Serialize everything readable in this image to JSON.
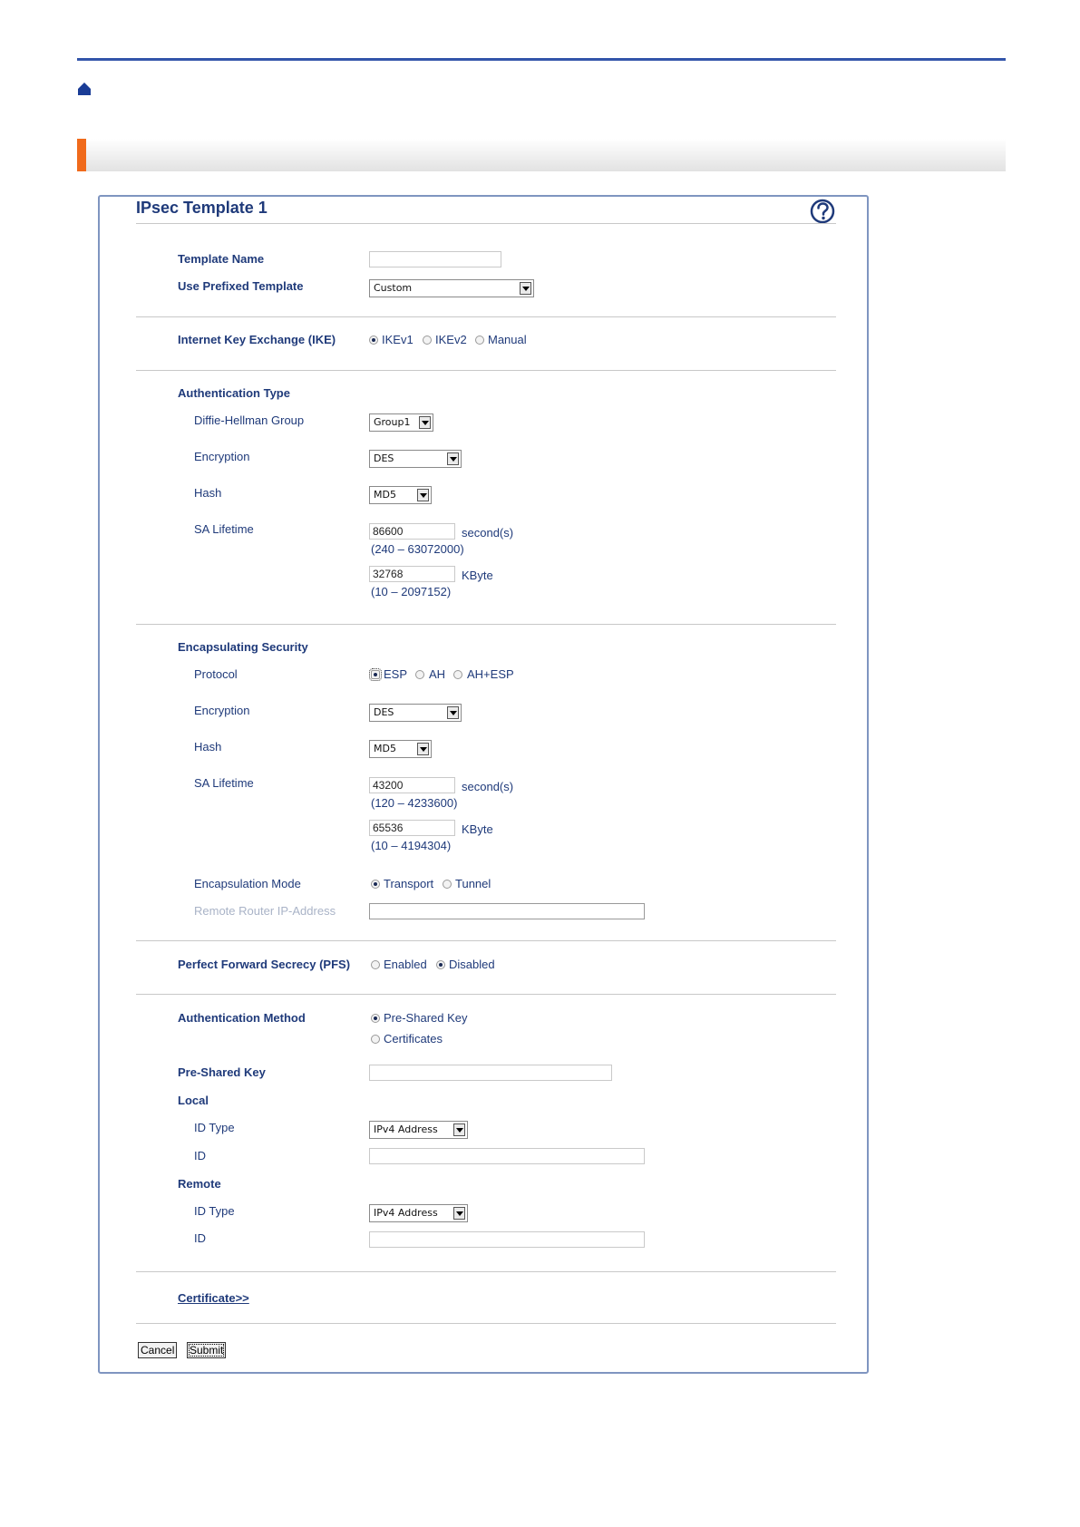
{
  "panel": {
    "title": "IPsec Template 1"
  },
  "fields": {
    "template_name": {
      "label": "Template Name",
      "value": ""
    },
    "prefixed_template": {
      "label": "Use Prefixed Template",
      "value": "Custom"
    },
    "ike": {
      "label": "Internet Key Exchange (IKE)",
      "options": [
        "IKEv1",
        "IKEv2",
        "Manual"
      ],
      "selected": "IKEv1"
    },
    "auth_type": {
      "heading": "Authentication Type",
      "dh_group": {
        "label": "Diffie-Hellman Group",
        "value": "Group1"
      },
      "encryption": {
        "label": "Encryption",
        "value": "DES"
      },
      "hash": {
        "label": "Hash",
        "value": "MD5"
      },
      "sa_lifetime": {
        "label": "SA Lifetime",
        "seconds_value": "86600",
        "seconds_unit": "second(s)",
        "seconds_range": "(240 – 63072000)",
        "kbyte_value": "32768",
        "kbyte_unit": "KByte",
        "kbyte_range": "(10 – 2097152)"
      }
    },
    "encap_security": {
      "heading": "Encapsulating Security",
      "protocol": {
        "label": "Protocol",
        "options": [
          "ESP",
          "AH",
          "AH+ESP"
        ],
        "selected": "ESP"
      },
      "encryption": {
        "label": "Encryption",
        "value": "DES"
      },
      "hash": {
        "label": "Hash",
        "value": "MD5"
      },
      "sa_lifetime": {
        "label": "SA Lifetime",
        "seconds_value": "43200",
        "seconds_unit": "second(s)",
        "seconds_range": "(120 – 4233600)",
        "kbyte_value": "65536",
        "kbyte_unit": "KByte",
        "kbyte_range": "(10 – 4194304)"
      },
      "mode": {
        "label": "Encapsulation Mode",
        "options": [
          "Transport",
          "Tunnel"
        ],
        "selected": "Transport"
      },
      "remote_router": {
        "label": "Remote Router IP-Address",
        "value": ""
      }
    },
    "pfs": {
      "label": "Perfect Forward Secrecy (PFS)",
      "options": [
        "Enabled",
        "Disabled"
      ],
      "selected": "Disabled"
    },
    "auth_method": {
      "label": "Authentication Method",
      "options": [
        "Pre-Shared Key",
        "Certificates"
      ],
      "selected": "Pre-Shared Key"
    },
    "pre_shared_key": {
      "label": "Pre-Shared Key",
      "value": ""
    },
    "local": {
      "heading": "Local",
      "id_type_label": "ID Type",
      "id_type_value": "IPv4 Address",
      "id_label": "ID",
      "id_value": ""
    },
    "remote": {
      "heading": "Remote",
      "id_type_label": "ID Type",
      "id_type_value": "IPv4 Address",
      "id_label": "ID",
      "id_value": ""
    }
  },
  "certificate_link": "Certificate>>",
  "buttons": {
    "cancel": "Cancel",
    "submit": "Submit"
  },
  "colors": {
    "accent": "#f06a1b",
    "rule": "#3355aa",
    "text": "#1f3a7a"
  }
}
